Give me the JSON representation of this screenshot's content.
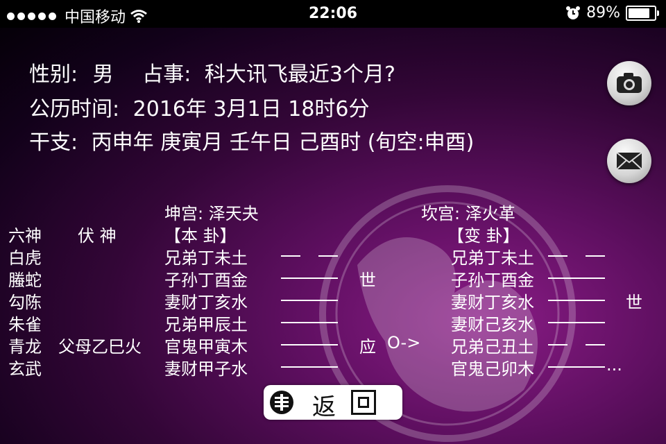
{
  "status_bar": {
    "carrier": "中国移动",
    "time": "22:06",
    "battery_percent_label": "89%",
    "battery_level": 0.89,
    "icons": [
      "signal-dots-icon",
      "wifi-icon",
      "alarm-clock-icon",
      "battery-icon"
    ]
  },
  "info": {
    "gender_label": "性别:",
    "gender_value": "男",
    "matter_label": "占事:",
    "matter_value": "科大讯飞最近3个月?",
    "date_label": "公历时间:",
    "date_value": "2016年 3月1日 18时6分",
    "ganzhi_label": "干支:",
    "ganzhi_value": "丙申年 庚寅月 壬午日 己酉时 (旬空:申酉)"
  },
  "buttons": {
    "camera_icon": "camera-icon",
    "mail_icon": "envelope-icon",
    "back_label_1": "返",
    "back_label_2": "回"
  },
  "hexagram": {
    "original_palace": "坤宫: 泽天夬",
    "changed_palace": "坎宫: 泽火革",
    "header_liushen": "六神",
    "header_fushen": "伏 神",
    "header_original": "【本   卦】",
    "header_changed": "【变   卦】",
    "rows": [
      {
        "liushen": "白虎",
        "fushen": "",
        "original": "兄弟丁未土",
        "orig_line": "yin",
        "orig_mark": "",
        "moving": "",
        "changed": "兄弟丁未土",
        "chg_line": "yin",
        "chg_mark": ""
      },
      {
        "liushen": "螣蛇",
        "fushen": "",
        "original": "子孙丁酉金",
        "orig_line": "yang",
        "orig_mark": "世",
        "moving": "",
        "changed": "子孙丁酉金",
        "chg_line": "yang",
        "chg_mark": ""
      },
      {
        "liushen": "勾陈",
        "fushen": "",
        "original": "妻财丁亥水",
        "orig_line": "yang",
        "orig_mark": "",
        "moving": "",
        "changed": "妻财丁亥水",
        "chg_line": "yang",
        "chg_mark": "世"
      },
      {
        "liushen": "朱雀",
        "fushen": "",
        "original": "兄弟甲辰土",
        "orig_line": "yang",
        "orig_mark": "",
        "moving": "",
        "changed": "妻财己亥水",
        "chg_line": "yang",
        "chg_mark": ""
      },
      {
        "liushen": "青龙",
        "fushen": "父母乙巳火",
        "original": "官鬼甲寅木",
        "orig_line": "yang",
        "orig_mark": "应",
        "moving": "O->",
        "changed": "兄弟己丑土",
        "chg_line": "yin",
        "chg_mark": ""
      },
      {
        "liushen": "玄武",
        "fushen": "",
        "original": "妻财甲子水",
        "orig_line": "yang",
        "orig_mark": "",
        "moving": "",
        "changed": "官鬼己卯木",
        "chg_line": "yang",
        "chg_mark": "..."
      }
    ]
  }
}
